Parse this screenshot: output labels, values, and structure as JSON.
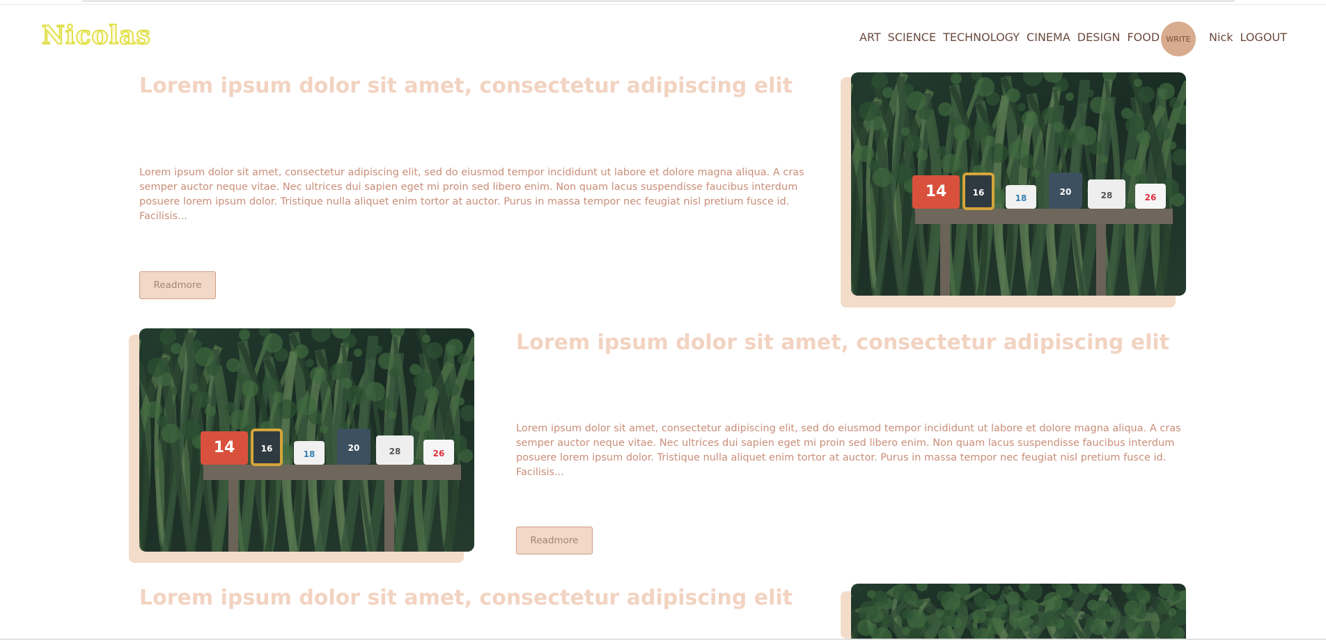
{
  "header": {
    "logo": "Nicolas",
    "nav": [
      "ART",
      "SCIENCE",
      "TECHNOLOGY",
      "CINEMA",
      "DESIGN",
      "FOOD"
    ],
    "write_label": "WRITE",
    "username": "Nick",
    "logout_label": "LOGOUT"
  },
  "posts": [
    {
      "title": "Lorem ipsum dolor sit amet, consectetur adipiscing elit",
      "excerpt": "Lorem ipsum dolor sit amet, consectetur adipiscing elit, sed do eiusmod tempor incididunt ut labore et dolore magna aliqua. A cras semper auctor neque vitae. Nec ultrices dui sapien eget mi proin sed libero enim. Non quam lacus suspendisse faucibus interdum posuere lorem ipsum dolor. Tristique nulla aliquet enim tortor at auctor. Purus in massa tempor nec feugiat nisl pretium fusce id. Facilisis...",
      "readmore": "Readmore"
    },
    {
      "title": "Lorem ipsum dolor sit amet, consectetur adipiscing elit",
      "excerpt": "Lorem ipsum dolor sit amet, consectetur adipiscing elit, sed do eiusmod tempor incididunt ut labore et dolore magna aliqua. A cras semper auctor neque vitae. Nec ultrices dui sapien eget mi proin sed libero enim. Non quam lacus suspendisse faucibus interdum posuere lorem ipsum dolor. Tristique nulla aliquet enim tortor at auctor. Purus in massa tempor nec feugiat nisl pretium fusce id. Facilisis...",
      "readmore": "Readmore"
    },
    {
      "title": "Lorem ipsum dolor sit amet, consectetur adipiscing elit"
    }
  ],
  "mailbox_numbers": [
    "14",
    "16",
    "18",
    "20",
    "28",
    "26"
  ],
  "colors": {
    "accent": "#d9ac8f",
    "title": "#f2d3c1",
    "text": "#c98d78",
    "logo": "#e1e04a"
  }
}
